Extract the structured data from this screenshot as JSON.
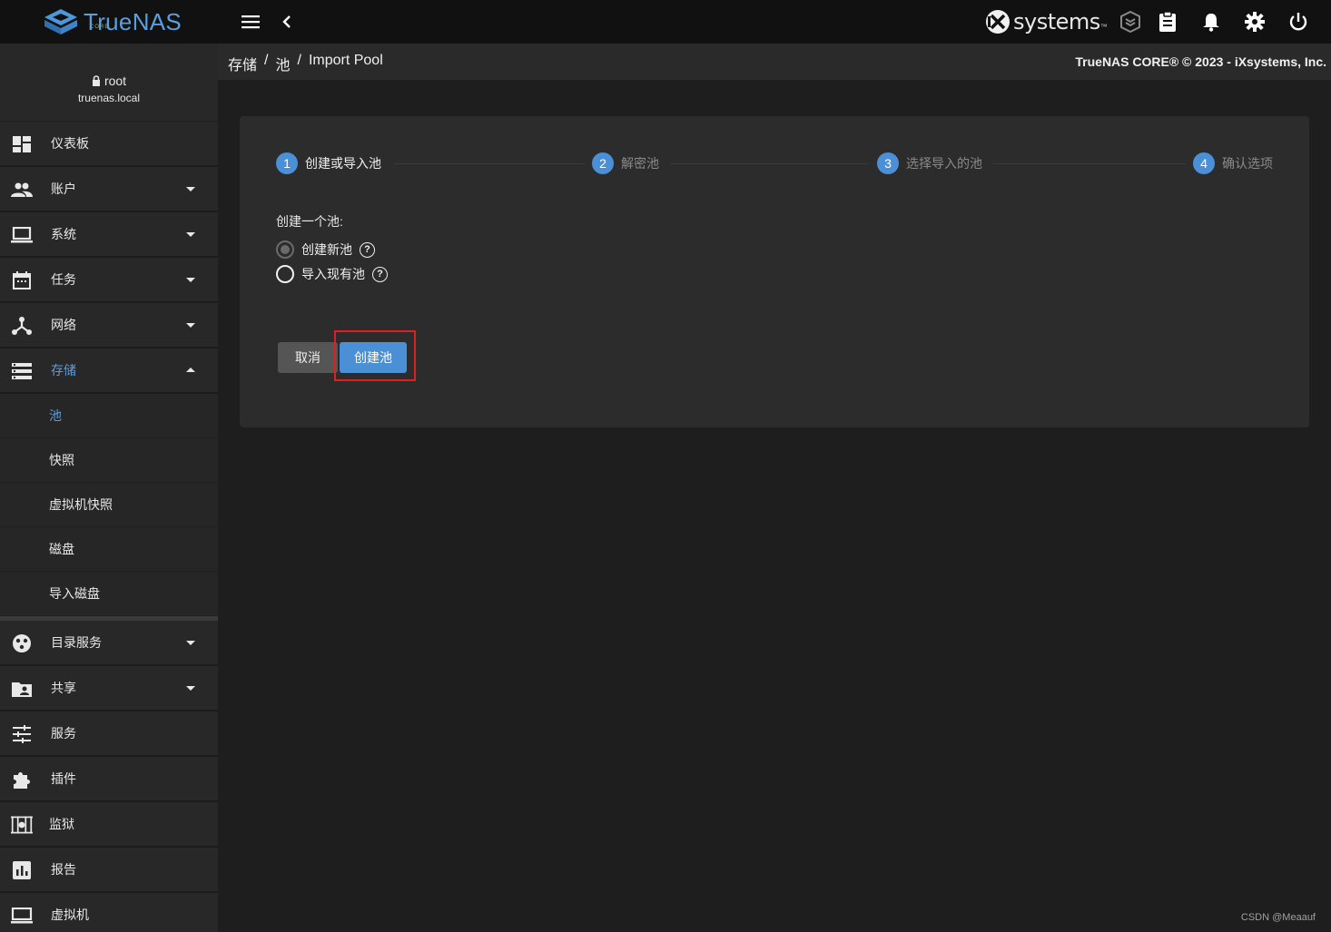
{
  "topbar": {
    "logo_text": "TrueNAS",
    "logo_sub": "CORE",
    "vendor_logo": "iXsystems",
    "icons": [
      "menu-icon",
      "back-chevron-icon",
      "truecommand-icon",
      "clipboard-icon",
      "bell-icon",
      "gear-icon",
      "power-icon"
    ]
  },
  "user": {
    "name": "root",
    "host": "truenas.local"
  },
  "sidebar": {
    "items": [
      {
        "label": "仪表板",
        "icon": "dashboard-icon"
      },
      {
        "label": "账户",
        "icon": "people-icon",
        "caret": true
      },
      {
        "label": "系统",
        "icon": "laptop-icon",
        "caret": true
      },
      {
        "label": "任务",
        "icon": "calendar-icon",
        "caret": true
      },
      {
        "label": "网络",
        "icon": "network-icon",
        "caret": true
      },
      {
        "label": "存储",
        "icon": "storage-icon",
        "caret": true,
        "expanded": true
      }
    ],
    "subitems": [
      {
        "label": "池",
        "active": true
      },
      {
        "label": "快照"
      },
      {
        "label": "虚拟机快照"
      },
      {
        "label": "磁盘"
      },
      {
        "label": "导入磁盘"
      }
    ],
    "items_after": [
      {
        "label": "目录服务",
        "icon": "directory-icon",
        "caret": true
      },
      {
        "label": "共享",
        "icon": "share-folder-icon",
        "caret": true
      },
      {
        "label": "服务",
        "icon": "tune-icon"
      },
      {
        "label": "插件",
        "icon": "puzzle-icon"
      },
      {
        "label": "监狱",
        "icon": "jail-icon"
      },
      {
        "label": "报告",
        "icon": "report-icon"
      },
      {
        "label": "虚拟机",
        "icon": "monitor-icon"
      }
    ]
  },
  "breadcrumb": {
    "items": [
      "存储",
      "池",
      "Import Pool"
    ],
    "separator": "/"
  },
  "copyright": "TrueNAS CORE® © 2023 - iXsystems, Inc.",
  "stepper": {
    "steps": [
      {
        "num": "1",
        "label": "创建或导入池",
        "active": true
      },
      {
        "num": "2",
        "label": "解密池"
      },
      {
        "num": "3",
        "label": "选择导入的池"
      },
      {
        "num": "4",
        "label": "确认选项"
      }
    ]
  },
  "form": {
    "label": "创建一个池:",
    "options": [
      {
        "label": "创建新池",
        "checked": true
      },
      {
        "label": "导入现有池",
        "checked": false
      }
    ],
    "help_glyph": "?"
  },
  "buttons": {
    "cancel": "取消",
    "create": "创建池"
  },
  "watermark": "CSDN @Meaauf",
  "colors": {
    "accent": "#4b8fd6",
    "highlight": "#e02020",
    "background": "#1e1e1e",
    "card": "#2c2c2c"
  }
}
